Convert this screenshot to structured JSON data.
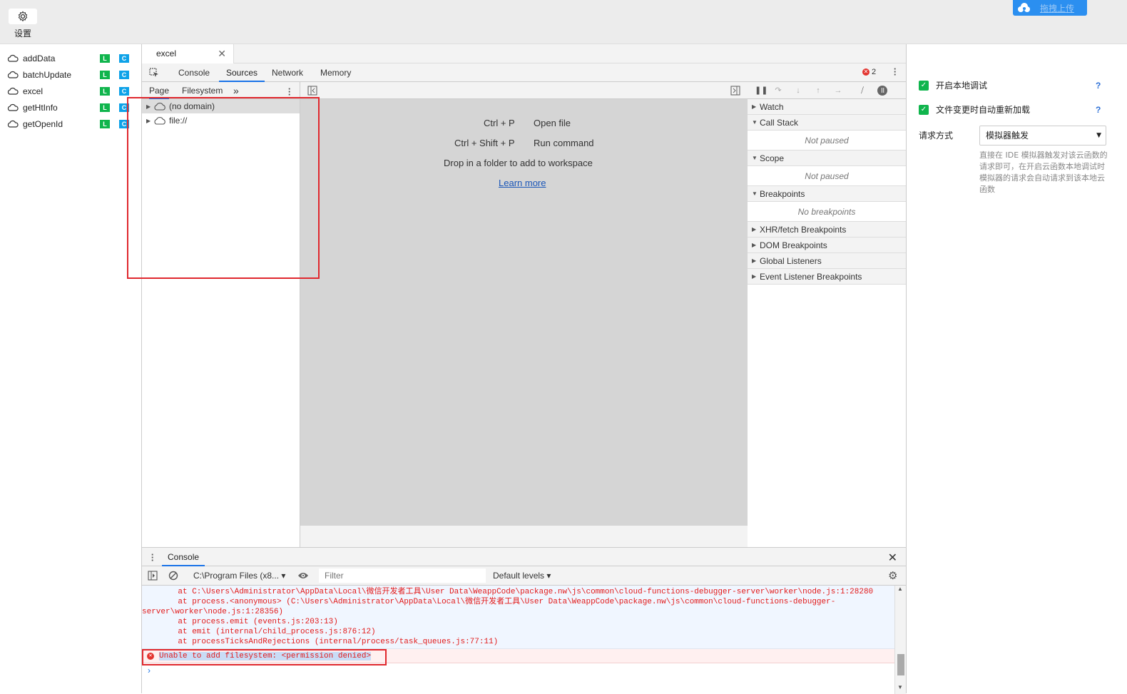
{
  "topbar": {
    "settings_label": "设置",
    "upload_label": "拖拽上传"
  },
  "functions": [
    {
      "name": "addData",
      "l": "L",
      "c": "C"
    },
    {
      "name": "batchUpdate",
      "l": "L",
      "c": "C"
    },
    {
      "name": "excel",
      "l": "L",
      "c": "C"
    },
    {
      "name": "getHtInfo",
      "l": "L",
      "c": "C"
    },
    {
      "name": "getOpenId",
      "l": "L",
      "c": "C"
    }
  ],
  "devtools": {
    "file_tab": "excel",
    "tabs": [
      "Console",
      "Sources",
      "Network",
      "Memory"
    ],
    "active_tab": "Sources",
    "error_count": "2",
    "navigator": {
      "tabs": [
        "Page",
        "Filesystem"
      ],
      "more": "»",
      "tree": [
        "(no domain)",
        "file://"
      ]
    },
    "editor": {
      "shortcut1_key": "Ctrl + P",
      "shortcut1_action": "Open file",
      "shortcut2_key": "Ctrl + Shift + P",
      "shortcut2_action": "Run command",
      "drop_hint": "Drop in a folder to add to workspace",
      "learn_more": "Learn more"
    },
    "debugger": {
      "watch": "Watch",
      "call_stack": "Call Stack",
      "call_stack_body": "Not paused",
      "scope": "Scope",
      "scope_body": "Not paused",
      "breakpoints": "Breakpoints",
      "breakpoints_body": "No breakpoints",
      "xhr": "XHR/fetch Breakpoints",
      "dom": "DOM Breakpoints",
      "global": "Global Listeners",
      "event": "Event Listener Breakpoints"
    },
    "console": {
      "tab": "Console",
      "context": "C:\\Program Files (x8...",
      "filter_placeholder": "Filter",
      "levels": "Default levels",
      "stack_lines": [
        "    at C:\\Users\\Administrator\\AppData\\Local\\微信开发者工具\\User Data\\WeappCode\\package.nw\\js\\common\\cloud-functions-debugger-server\\worker\\node.js:1:28280",
        "    at process.<anonymous> (C:\\Users\\Administrator\\AppData\\Local\\微信开发者工具\\User Data\\WeappCode\\package.nw\\js\\common\\cloud-functions-debugger-",
        "server\\worker\\node.js:1:28356)",
        "    at process.emit (events.js:203:13)",
        "    at emit (internal/child_process.js:876:12)",
        "    at processTicksAndRejections (internal/process/task_queues.js:77:11)"
      ],
      "error_message": "Unable to add filesystem: <permission denied>",
      "prompt": "›"
    }
  },
  "settings": {
    "local_debug": "开启本地调试",
    "auto_reload": "文件变更时自动重新加载",
    "help": "?",
    "request_label": "请求方式",
    "request_value": "模拟器触发",
    "request_desc": "直接在 IDE 模拟器触发对该云函数的请求即可，在开启云函数本地调试时模拟器的请求会自动请求到该本地云函数"
  },
  "colors": {
    "accent": "#1a73e8",
    "badge_l": "#10b54d",
    "badge_c": "#0ea2e8",
    "error": "#e21a1a",
    "annotation": "#e0282e"
  }
}
